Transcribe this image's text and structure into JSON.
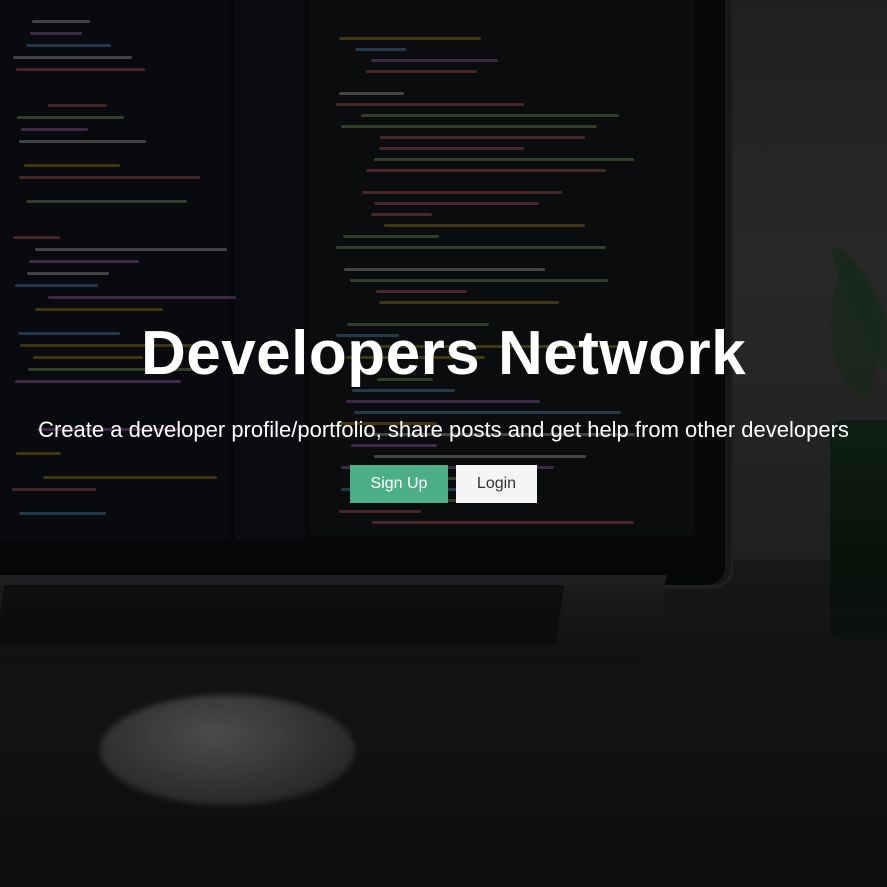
{
  "hero": {
    "title": "Developers Network",
    "lead": "Create a developer profile/portfolio, share posts and get help from other developers"
  },
  "actions": {
    "signup_label": "Sign Up",
    "login_label": "Login"
  },
  "colors": {
    "primary": "#4cae88",
    "light": "#f5f5f5",
    "overlay": "rgba(0,0,0,0.45)"
  }
}
